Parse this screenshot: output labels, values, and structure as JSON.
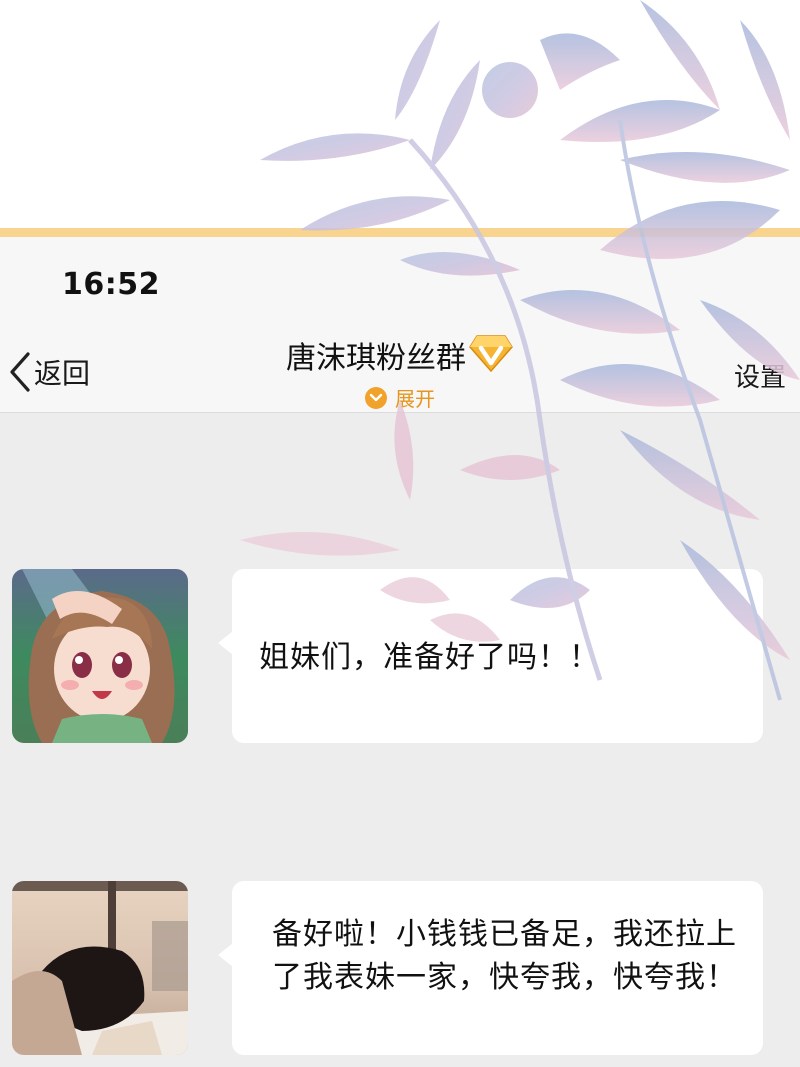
{
  "status_bar": {
    "time": "16:52"
  },
  "nav": {
    "back_label": "返回",
    "title": "唐沫琪粉丝群",
    "expand_label": "展开",
    "settings_label": "设置"
  },
  "messages": [
    {
      "avatar": "anime-girl-avatar",
      "text": "姐妹们，准备好了吗！！"
    },
    {
      "avatar": "photo-girl-avatar",
      "text": "备好啦！小钱钱已备足，我还拉上了我表妹一家，快夸我，快夸我！"
    }
  ],
  "colors": {
    "accent_stripe": "#f9d48e",
    "expand_orange": "#f0a22b",
    "chat_background": "#ededed",
    "bubble": "#ffffff"
  }
}
